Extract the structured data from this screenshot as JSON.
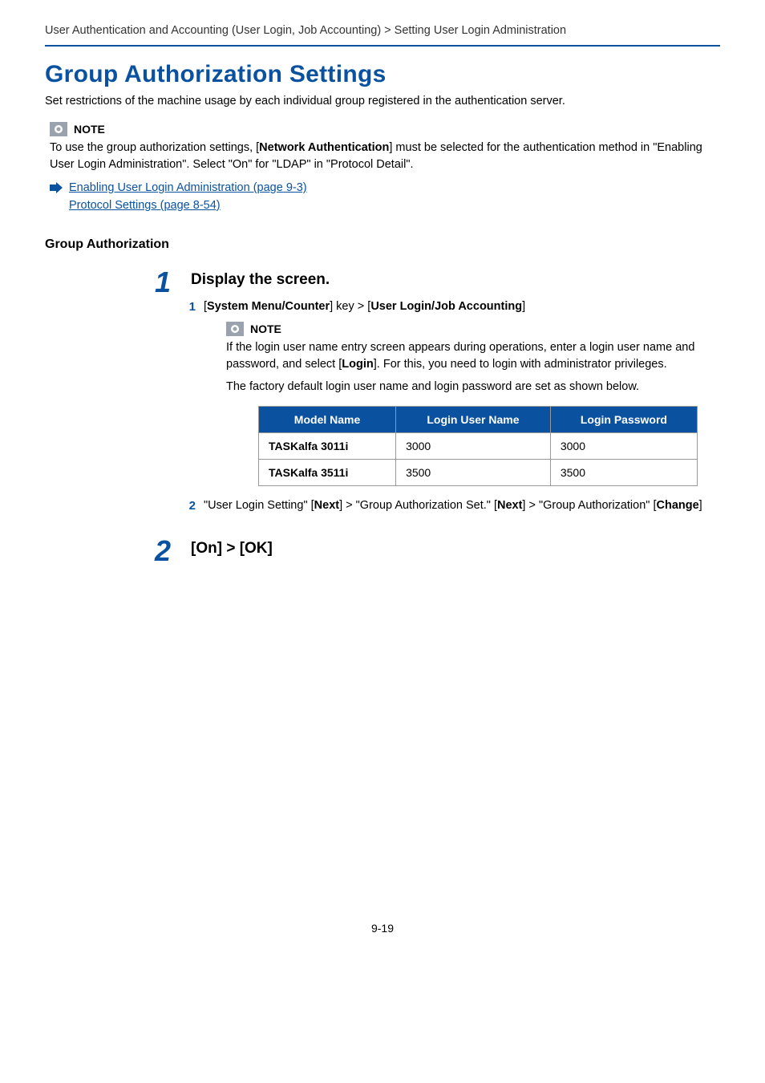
{
  "breadcrumb": "User Authentication and Accounting (User Login, Job Accounting) > Setting User Login Administration",
  "title": "Group Authorization Settings",
  "intro": "Set restrictions of the machine usage by each individual group registered in the authentication server.",
  "note1": {
    "label": "NOTE",
    "body_pre": "To use the group authorization settings, [",
    "body_bold": "Network Authentication",
    "body_post": "] must be selected for the authentication method in \"Enabling User Login Administration\". Select \"On\" for \"LDAP\" in \"Protocol Detail\"."
  },
  "links": {
    "l1": "Enabling User Login Administration (page 9-3)",
    "l2": "Protocol Settings (page 8-54)"
  },
  "subhead": "Group Authorization",
  "step1": {
    "num": "1",
    "title": "Display the screen.",
    "sub1": {
      "num": "1",
      "t1": "[",
      "b1": "System Menu/Counter",
      "t2": "] key > [",
      "b2": "User Login/Job Accounting",
      "t3": "]"
    },
    "note": {
      "label": "NOTE",
      "p1_pre": "If the login user name entry screen appears during operations, enter a login user name and password, and select [",
      "p1_b": "Login",
      "p1_post": "]. For this, you need to login with administrator privileges.",
      "p2": "The factory default login user name and login password are set as shown below."
    },
    "table": {
      "h1": "Model Name",
      "h2": "Login User Name",
      "h3": "Login Password",
      "rows": [
        {
          "model": "TASKalfa 3011i",
          "user": "3000",
          "pass": "3000"
        },
        {
          "model": "TASKalfa 3511i",
          "user": "3500",
          "pass": "3500"
        }
      ]
    },
    "sub2": {
      "num": "2",
      "t1": "\"User Login Setting\" [",
      "b1": "Next",
      "t2": "] > \"Group Authorization Set.\" [",
      "b2": "Next",
      "t3": "] > \"Group Authorization\" [",
      "b3": "Change",
      "t4": "]"
    }
  },
  "step2": {
    "num": "2",
    "title": "[On] > [OK]"
  },
  "page_number": "9-19"
}
